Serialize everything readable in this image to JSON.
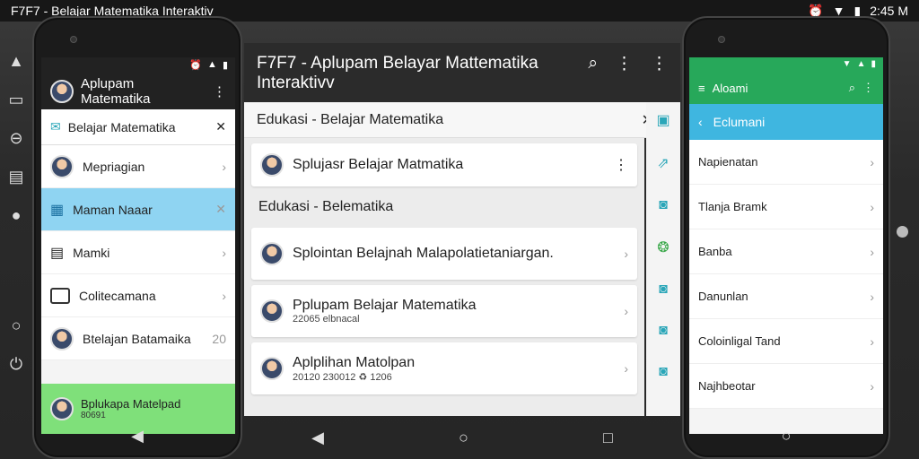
{
  "system": {
    "title": "F7F7 - Belajar Matematika Interaktiv",
    "time": "2:45 M"
  },
  "left_phone": {
    "header_title": "Aplupam Matematika",
    "search_text": "Belajar Matematika",
    "items": [
      {
        "label": "Mepriagian",
        "icon": "avatar-icon"
      },
      {
        "label": "Maman Naaar",
        "icon": "grid-icon",
        "selected": true
      },
      {
        "label": "Mamki",
        "icon": "clipboard-icon"
      },
      {
        "label": "Colitecamana",
        "icon": "box-icon"
      },
      {
        "label": "Btelajan Batamaika",
        "icon": "avatar-icon",
        "badge": "20"
      }
    ],
    "green_item": {
      "title": "Bplukapa Matelpad",
      "sub": "80691"
    }
  },
  "middle": {
    "title": "F7F7 - Aplupam Belayar Mattematika Interaktivv",
    "search_text": "Edukasi - Belajar Matematika",
    "cards": [
      {
        "title": "Splujasr Belajar Matmatika",
        "sub": ""
      },
      {
        "title": "Splointan Belajnah Malapolatietaniargan.",
        "sub": ""
      },
      {
        "title": "Pplupam Belajar Matematika",
        "sub": "22065 elbnacal"
      },
      {
        "title": "Aplplihan Matolpan",
        "sub": "20120 230012 ♻ 1206"
      }
    ],
    "section": "Edukasi - Belematika"
  },
  "right_phone": {
    "appbar_title": "Aloami",
    "subheader": "Eclumani",
    "items": [
      "Napienatan",
      "Tlanja Bramk",
      "Banba",
      "Danunlan",
      "Coloinligal Tand",
      "Najhbeotar"
    ]
  },
  "colors": {
    "green": "#27a85a",
    "blue": "#3fb6e0",
    "select": "#8fd4f2"
  }
}
